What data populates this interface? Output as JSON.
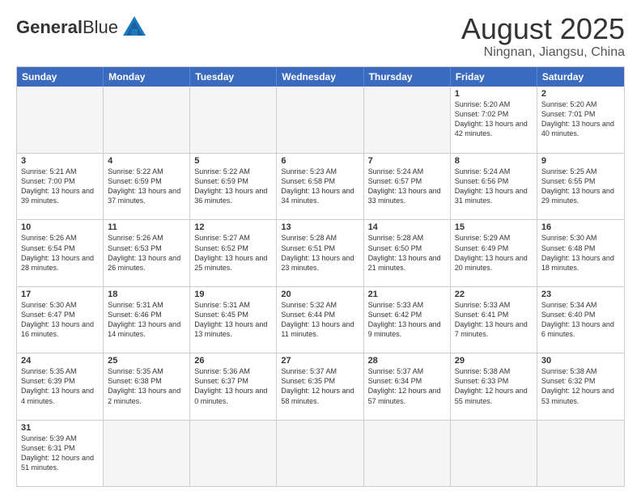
{
  "header": {
    "logo_general": "General",
    "logo_blue": "Blue",
    "month_year": "August 2025",
    "location": "Ningnan, Jiangsu, China"
  },
  "days_of_week": [
    "Sunday",
    "Monday",
    "Tuesday",
    "Wednesday",
    "Thursday",
    "Friday",
    "Saturday"
  ],
  "weeks": [
    [
      {
        "day": "",
        "info": "",
        "empty": true
      },
      {
        "day": "",
        "info": "",
        "empty": true
      },
      {
        "day": "",
        "info": "",
        "empty": true
      },
      {
        "day": "",
        "info": "",
        "empty": true
      },
      {
        "day": "",
        "info": "",
        "empty": true
      },
      {
        "day": "1",
        "info": "Sunrise: 5:20 AM\nSunset: 7:02 PM\nDaylight: 13 hours and 42 minutes."
      },
      {
        "day": "2",
        "info": "Sunrise: 5:20 AM\nSunset: 7:01 PM\nDaylight: 13 hours and 40 minutes."
      }
    ],
    [
      {
        "day": "3",
        "info": "Sunrise: 5:21 AM\nSunset: 7:00 PM\nDaylight: 13 hours and 39 minutes."
      },
      {
        "day": "4",
        "info": "Sunrise: 5:22 AM\nSunset: 6:59 PM\nDaylight: 13 hours and 37 minutes."
      },
      {
        "day": "5",
        "info": "Sunrise: 5:22 AM\nSunset: 6:59 PM\nDaylight: 13 hours and 36 minutes."
      },
      {
        "day": "6",
        "info": "Sunrise: 5:23 AM\nSunset: 6:58 PM\nDaylight: 13 hours and 34 minutes."
      },
      {
        "day": "7",
        "info": "Sunrise: 5:24 AM\nSunset: 6:57 PM\nDaylight: 13 hours and 33 minutes."
      },
      {
        "day": "8",
        "info": "Sunrise: 5:24 AM\nSunset: 6:56 PM\nDaylight: 13 hours and 31 minutes."
      },
      {
        "day": "9",
        "info": "Sunrise: 5:25 AM\nSunset: 6:55 PM\nDaylight: 13 hours and 29 minutes."
      }
    ],
    [
      {
        "day": "10",
        "info": "Sunrise: 5:26 AM\nSunset: 6:54 PM\nDaylight: 13 hours and 28 minutes."
      },
      {
        "day": "11",
        "info": "Sunrise: 5:26 AM\nSunset: 6:53 PM\nDaylight: 13 hours and 26 minutes."
      },
      {
        "day": "12",
        "info": "Sunrise: 5:27 AM\nSunset: 6:52 PM\nDaylight: 13 hours and 25 minutes."
      },
      {
        "day": "13",
        "info": "Sunrise: 5:28 AM\nSunset: 6:51 PM\nDaylight: 13 hours and 23 minutes."
      },
      {
        "day": "14",
        "info": "Sunrise: 5:28 AM\nSunset: 6:50 PM\nDaylight: 13 hours and 21 minutes."
      },
      {
        "day": "15",
        "info": "Sunrise: 5:29 AM\nSunset: 6:49 PM\nDaylight: 13 hours and 20 minutes."
      },
      {
        "day": "16",
        "info": "Sunrise: 5:30 AM\nSunset: 6:48 PM\nDaylight: 13 hours and 18 minutes."
      }
    ],
    [
      {
        "day": "17",
        "info": "Sunrise: 5:30 AM\nSunset: 6:47 PM\nDaylight: 13 hours and 16 minutes."
      },
      {
        "day": "18",
        "info": "Sunrise: 5:31 AM\nSunset: 6:46 PM\nDaylight: 13 hours and 14 minutes."
      },
      {
        "day": "19",
        "info": "Sunrise: 5:31 AM\nSunset: 6:45 PM\nDaylight: 13 hours and 13 minutes."
      },
      {
        "day": "20",
        "info": "Sunrise: 5:32 AM\nSunset: 6:44 PM\nDaylight: 13 hours and 11 minutes."
      },
      {
        "day": "21",
        "info": "Sunrise: 5:33 AM\nSunset: 6:42 PM\nDaylight: 13 hours and 9 minutes."
      },
      {
        "day": "22",
        "info": "Sunrise: 5:33 AM\nSunset: 6:41 PM\nDaylight: 13 hours and 7 minutes."
      },
      {
        "day": "23",
        "info": "Sunrise: 5:34 AM\nSunset: 6:40 PM\nDaylight: 13 hours and 6 minutes."
      }
    ],
    [
      {
        "day": "24",
        "info": "Sunrise: 5:35 AM\nSunset: 6:39 PM\nDaylight: 13 hours and 4 minutes."
      },
      {
        "day": "25",
        "info": "Sunrise: 5:35 AM\nSunset: 6:38 PM\nDaylight: 13 hours and 2 minutes."
      },
      {
        "day": "26",
        "info": "Sunrise: 5:36 AM\nSunset: 6:37 PM\nDaylight: 13 hours and 0 minutes."
      },
      {
        "day": "27",
        "info": "Sunrise: 5:37 AM\nSunset: 6:35 PM\nDaylight: 12 hours and 58 minutes."
      },
      {
        "day": "28",
        "info": "Sunrise: 5:37 AM\nSunset: 6:34 PM\nDaylight: 12 hours and 57 minutes."
      },
      {
        "day": "29",
        "info": "Sunrise: 5:38 AM\nSunset: 6:33 PM\nDaylight: 12 hours and 55 minutes."
      },
      {
        "day": "30",
        "info": "Sunrise: 5:38 AM\nSunset: 6:32 PM\nDaylight: 12 hours and 53 minutes."
      }
    ],
    [
      {
        "day": "31",
        "info": "Sunrise: 5:39 AM\nSunset: 6:31 PM\nDaylight: 12 hours and 51 minutes."
      },
      {
        "day": "",
        "info": "",
        "empty": true
      },
      {
        "day": "",
        "info": "",
        "empty": true
      },
      {
        "day": "",
        "info": "",
        "empty": true
      },
      {
        "day": "",
        "info": "",
        "empty": true
      },
      {
        "day": "",
        "info": "",
        "empty": true
      },
      {
        "day": "",
        "info": "",
        "empty": true
      }
    ]
  ]
}
